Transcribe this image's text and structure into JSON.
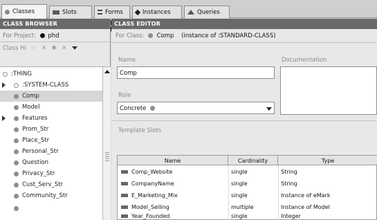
{
  "tabs": [
    {
      "label": "Classes",
      "icon": "class-dot-icon"
    },
    {
      "label": "Slots",
      "icon": "slot-icon"
    },
    {
      "label": "Forms",
      "icon": "forms-icon"
    },
    {
      "label": "Instances",
      "icon": "instances-diamond-icon"
    },
    {
      "label": "Queries",
      "icon": "queries-triangle-icon"
    }
  ],
  "browser": {
    "header": "CLASS BROWSER",
    "project_label": "For Project:",
    "project_name": "phd",
    "hierarchy_label": "Class Hi",
    "tree": [
      {
        "label": ":THING",
        "expander": false
      },
      {
        "label": ":SYSTEM-CLASS",
        "expander": true
      },
      {
        "label": "Comp",
        "expander": false,
        "selected": true
      },
      {
        "label": "Model",
        "expander": false
      },
      {
        "label": "Features",
        "expander": true
      },
      {
        "label": "Prom_Str",
        "expander": false
      },
      {
        "label": "Place_Str",
        "expander": false
      },
      {
        "label": "Personal_Str",
        "expander": false
      },
      {
        "label": "Question",
        "expander": false
      },
      {
        "label": "Privacy_Str",
        "expander": false
      },
      {
        "label": "Cust_Serv_Str",
        "expander": false
      },
      {
        "label": "Community_Str",
        "expander": false
      }
    ]
  },
  "editor": {
    "header": "CLASS EDITOR",
    "for_class_label": "For Class:",
    "class_name": "Comp",
    "instance_of": "(instance of :STANDARD-CLASS)",
    "name_label": "Name",
    "name_value": "Comp",
    "documentation_label": "Documentation",
    "role_label": "Role",
    "role_value": "Concrete",
    "template_slots_label": "Template Slots",
    "columns": [
      "Name",
      "Cardinality",
      "Type"
    ],
    "slots": [
      {
        "name": "Comp_Website",
        "cardinality": "single",
        "type": "String"
      },
      {
        "name": "CompanyName",
        "cardinality": "single",
        "type": "String"
      },
      {
        "name": "E_Marketing_Mix",
        "cardinality": "single",
        "type": "Instance of eMark"
      },
      {
        "name": "Model_Selling",
        "cardinality": "multiple",
        "type": "Instance of Model"
      },
      {
        "name": "Year_Founded",
        "cardinality": "single",
        "type": "Integer"
      }
    ]
  },
  "colors": {
    "header_bg": "#6a6a6a",
    "panel_bg": "#e8e8e8",
    "selected_row": "#d6d6d6"
  }
}
